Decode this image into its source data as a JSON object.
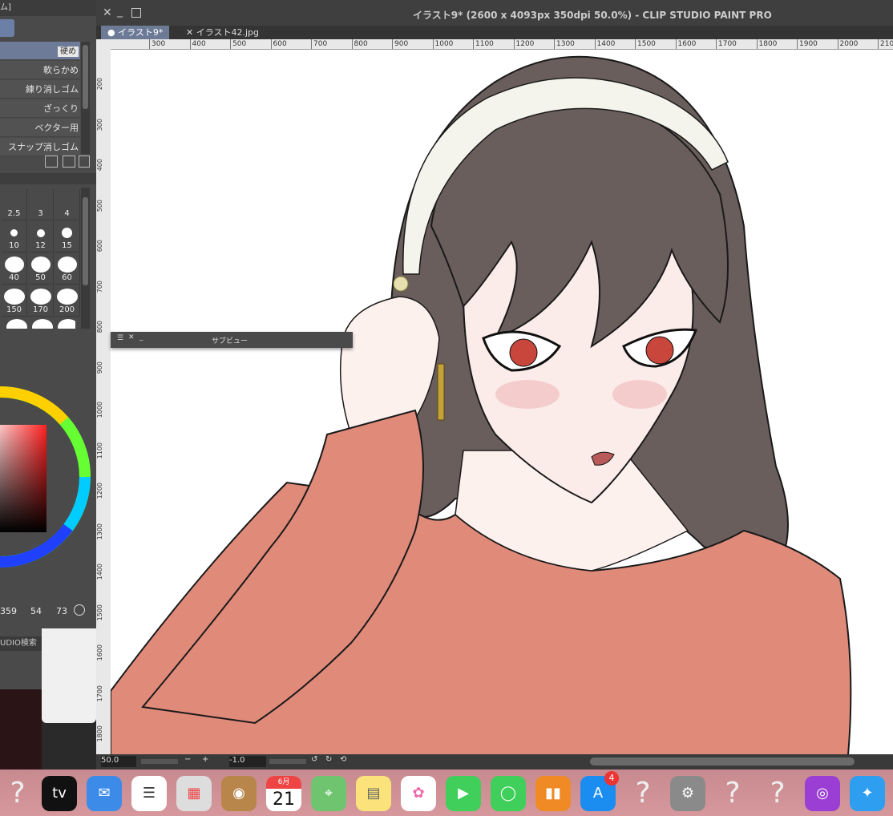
{
  "left_panel": {
    "title_fragment": "ム]",
    "brush_items": [
      {
        "label": "硬め",
        "selected": true
      },
      {
        "label": "軟らかめ"
      },
      {
        "label": "練り消しゴム"
      },
      {
        "label": "ざっくり"
      },
      {
        "label": "ベクター用"
      },
      {
        "label": "スナップ消しゴム"
      }
    ],
    "brush_sizes": [
      "2.5",
      "3",
      "4",
      "10",
      "12",
      "15",
      "40",
      "50",
      "60",
      "150",
      "170",
      "200"
    ],
    "color_values": {
      "h": "359",
      "s": "54",
      "v": "73"
    },
    "search_label": "UDIO検索"
  },
  "canvas_window": {
    "title": "イラスト9* (2600 x 4093px 350dpi 50.0%)  - CLIP STUDIO PAINT PRO",
    "tabs": [
      {
        "label": "イラスト9*",
        "active": true
      },
      {
        "label": "イラスト42.jpg",
        "active": false
      }
    ],
    "ruler_h": [
      "300",
      "400",
      "500",
      "600",
      "700",
      "800",
      "900",
      "1000",
      "1100",
      "1200",
      "1300",
      "1400",
      "1500",
      "1600",
      "1700",
      "1800",
      "1900",
      "2000",
      "2100"
    ],
    "ruler_v": [
      "200",
      "300",
      "400",
      "500",
      "600",
      "700",
      "800",
      "900",
      "1000",
      "1100",
      "1200",
      "1300",
      "1400",
      "1500",
      "1600",
      "1700",
      "1800"
    ],
    "zoom_value": "50.0",
    "rotation_value": "-1.0"
  },
  "subview": {
    "title": "サブビュー"
  },
  "dock": {
    "calendar_month": "6月",
    "calendar_day": "21",
    "appstore_badge": "4",
    "tv_label": "tv"
  },
  "colors": {
    "accent": "#6c7a96",
    "sweater": "#e08a7a",
    "hair": "#6a5e5c",
    "eye": "#c8463c"
  }
}
